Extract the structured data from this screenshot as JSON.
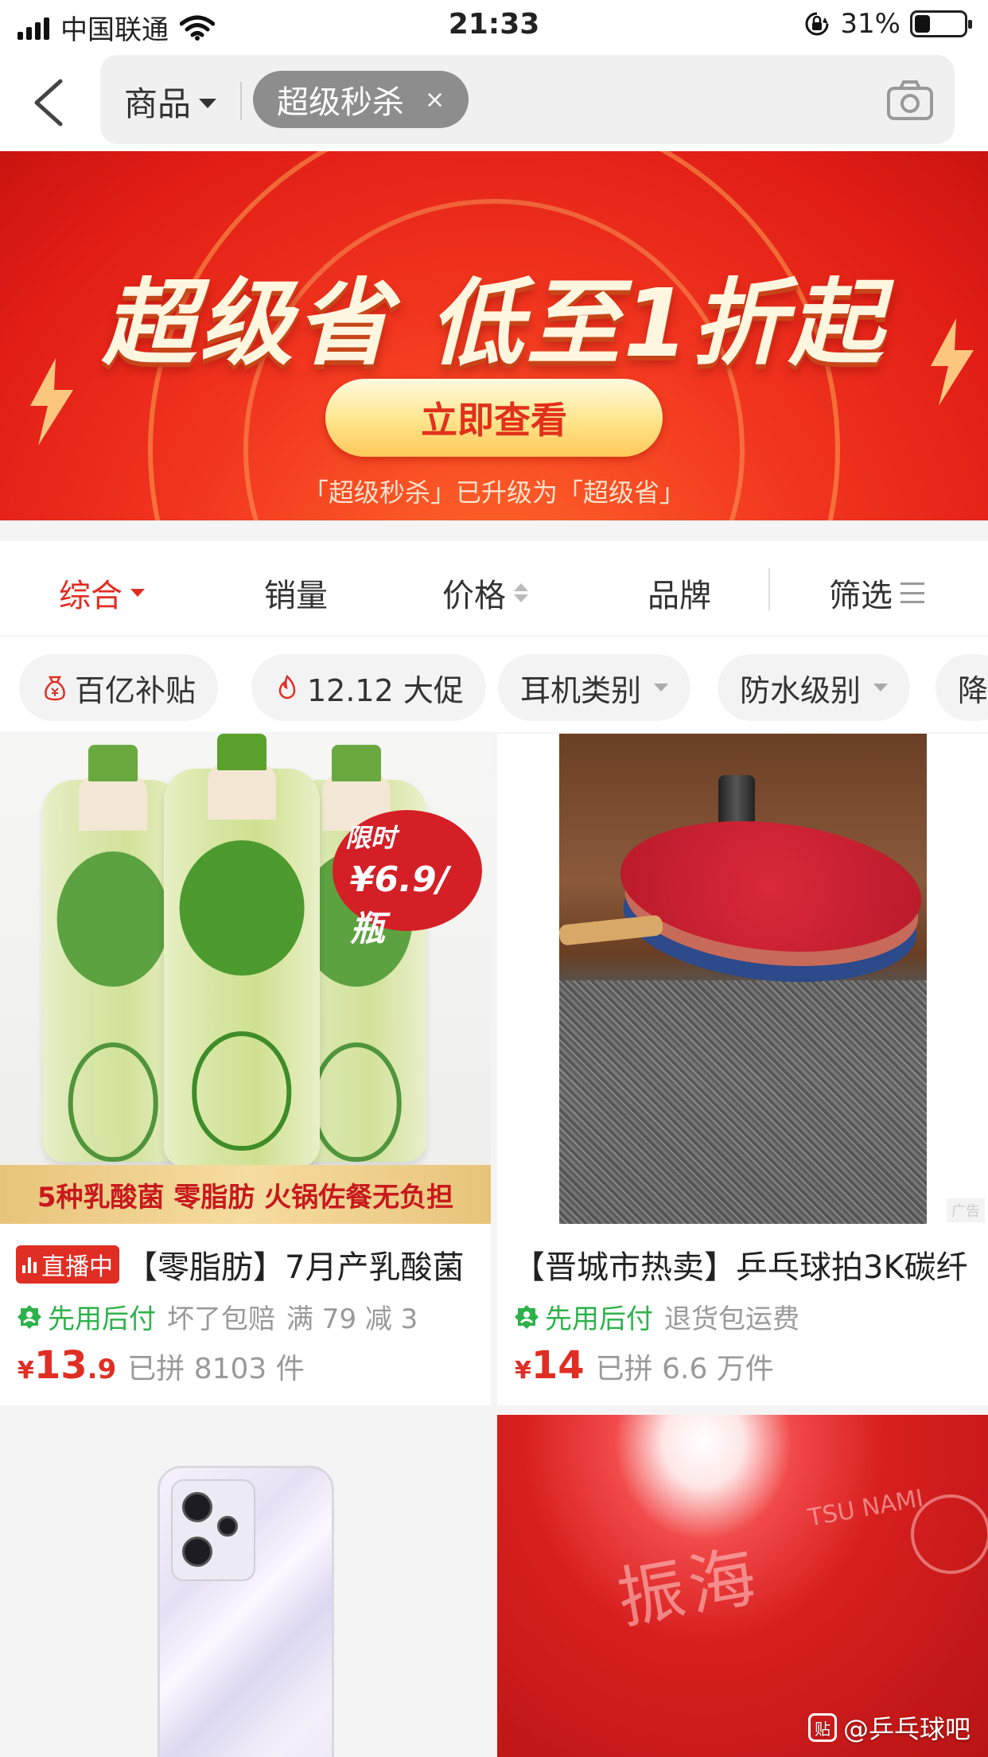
{
  "status_bar": {
    "carrier": "中国联通",
    "time": "21:33",
    "battery": "31%",
    "battery_level": 0.31
  },
  "search": {
    "scope_label": "商品",
    "tag_label": "超级秒杀",
    "tag_close": "×"
  },
  "banner": {
    "headline": "超级省 低至1折起",
    "button_label": "立即查看",
    "subtitle": "「超级秒杀」已升级为「超级省」"
  },
  "sort_bar": {
    "items": [
      "综合",
      "销量",
      "价格",
      "品牌",
      "筛选"
    ]
  },
  "filters": {
    "chips": [
      "百亿补贴",
      "12.12 大促",
      "耳机类别",
      "防水级别",
      "降"
    ]
  },
  "products": [
    {
      "image_promo_tag": "限时",
      "image_promo_price": "¥6.9/瓶",
      "image_strip": "5种乳酸菌 零脂肪 火锅佐餐无负担",
      "live_badge": "直播中",
      "title": "【零脂肪】7月产乳酸菌",
      "pay_later": "先用后付",
      "tags": [
        "坏了包赔",
        "满 79 减 3"
      ],
      "price_currency": "¥",
      "price_int": "13",
      "price_dec": ".9",
      "sold": "已拼 8103 件"
    },
    {
      "ad_mark": "广告",
      "title": "【晋城市热卖】乒乓球拍3K碳纤",
      "pay_later": "先用后付",
      "tags": [
        "退货包运费"
      ],
      "price_currency": "¥",
      "price_int": "14",
      "price_dec": "",
      "sold": "已拼 6.6 万件"
    }
  ],
  "watermark": {
    "text": "@乒乓球吧",
    "logo": "贴"
  },
  "colors": {
    "accent": "#e02e24",
    "pay_green": "#2db24a",
    "banner_red": "#e11d16"
  }
}
